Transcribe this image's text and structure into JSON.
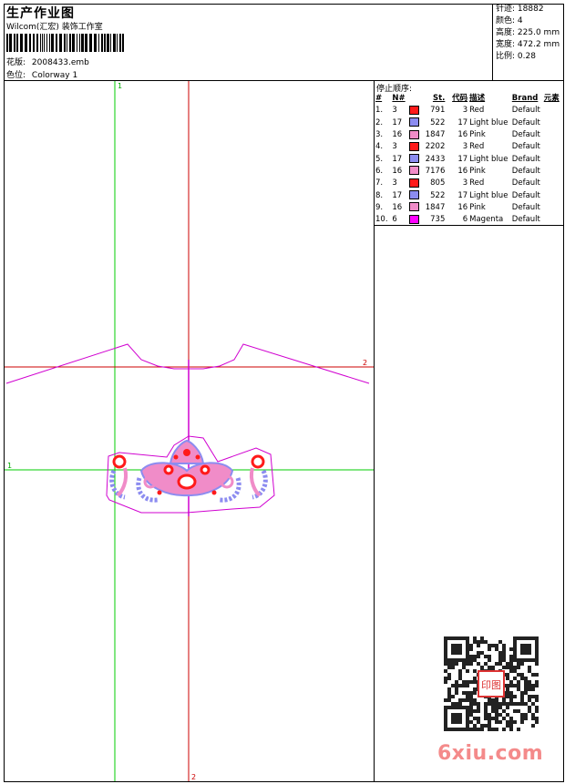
{
  "header": {
    "title": "生产作业图",
    "company": "Wilcom(汇宏) 装饰工作室",
    "file_label": "花版:",
    "file_value": "2008433.emb",
    "colorway_label": "色位:",
    "colorway_value": "Colorway 1"
  },
  "stats": [
    {
      "label": "针迹:",
      "value": "18882"
    },
    {
      "label": "颜色:",
      "value": "4"
    },
    {
      "label": "高度:",
      "value": "225.0 mm"
    },
    {
      "label": "宽度:",
      "value": "472.2 mm"
    },
    {
      "label": "比例:",
      "value": "0.28"
    }
  ],
  "sequence": {
    "title": "停止顺序:",
    "headers": [
      "#",
      "N#",
      "St.",
      "代码",
      "描述",
      "Brand",
      "元素"
    ],
    "rows": [
      {
        "num": "1.",
        "n": "3",
        "color": "#ff1a1a",
        "st": "791",
        "code": "3",
        "desc": "Red",
        "brand": "Default"
      },
      {
        "num": "2.",
        "n": "17",
        "color": "#8c8cf0",
        "st": "522",
        "code": "17",
        "desc": "Light blue",
        "brand": "Default"
      },
      {
        "num": "3.",
        "n": "16",
        "color": "#f08cc8",
        "st": "1847",
        "code": "16",
        "desc": "Pink",
        "brand": "Default"
      },
      {
        "num": "4.",
        "n": "3",
        "color": "#ff1a1a",
        "st": "2202",
        "code": "3",
        "desc": "Red",
        "brand": "Default"
      },
      {
        "num": "5.",
        "n": "17",
        "color": "#8c8cf0",
        "st": "2433",
        "code": "17",
        "desc": "Light blue",
        "brand": "Default"
      },
      {
        "num": "6.",
        "n": "16",
        "color": "#f08cc8",
        "st": "7176",
        "code": "16",
        "desc": "Pink",
        "brand": "Default"
      },
      {
        "num": "7.",
        "n": "3",
        "color": "#ff1a1a",
        "st": "805",
        "code": "3",
        "desc": "Red",
        "brand": "Default"
      },
      {
        "num": "8.",
        "n": "17",
        "color": "#8c8cf0",
        "st": "522",
        "code": "17",
        "desc": "Light blue",
        "brand": "Default"
      },
      {
        "num": "9.",
        "n": "16",
        "color": "#f08cc8",
        "st": "1847",
        "code": "16",
        "desc": "Pink",
        "brand": "Default"
      },
      {
        "num": "10.",
        "n": "6",
        "color": "#ff00ff",
        "st": "735",
        "code": "6",
        "desc": "Magenta",
        "brand": "Default"
      }
    ]
  },
  "canvas": {
    "guide_labels": {
      "top": "1",
      "left": "1",
      "right": "2",
      "bottom": "2"
    },
    "colors": {
      "guide_green": "#00cc00",
      "guide_red": "#cc0000",
      "outline": "#d000d0"
    }
  },
  "watermark": {
    "text": "6xiu.com",
    "seal_text": "印图"
  }
}
